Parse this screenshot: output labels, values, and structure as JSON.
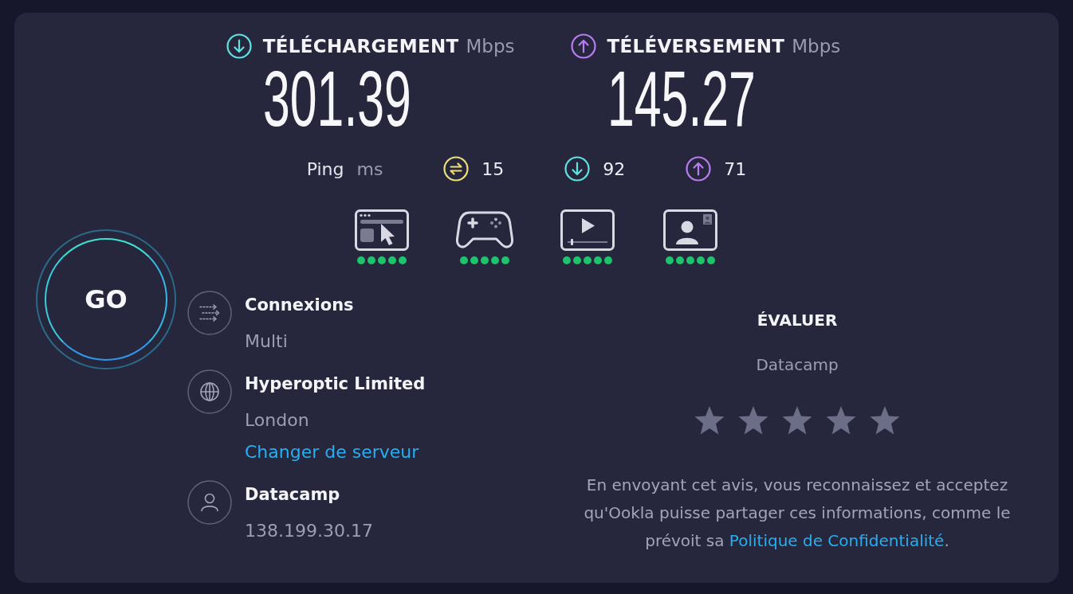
{
  "results": [
    {
      "kind": "download",
      "label": "TÉLÉCHARGEMENT",
      "unit": "Mbps",
      "value": "301.39"
    },
    {
      "kind": "upload",
      "label": "TÉLÉVERSEMENT",
      "unit": "Mbps",
      "value": "145.27"
    }
  ],
  "ping": {
    "label": "Ping",
    "unit": "ms",
    "readings": [
      {
        "kind": "idle",
        "value": "15"
      },
      {
        "kind": "download",
        "value": "92"
      },
      {
        "kind": "upload",
        "value": "71"
      }
    ]
  },
  "activities": [
    {
      "kind": "browsing",
      "stars": 5
    },
    {
      "kind": "gaming",
      "stars": 5
    },
    {
      "kind": "streaming",
      "stars": 5
    },
    {
      "kind": "video_call",
      "stars": 5
    }
  ],
  "go_button": {
    "label": "GO"
  },
  "connection": [
    {
      "kind": "connections",
      "title": "Connexions",
      "detail": "Multi"
    },
    {
      "kind": "server",
      "title": "Hyperoptic Limited",
      "detail": "London",
      "link": "Changer de serveur"
    },
    {
      "kind": "client",
      "title": "Datacamp",
      "detail": "138.199.30.17"
    }
  ],
  "rating": {
    "title": "ÉVALUER",
    "subject": "Datacamp",
    "notice": {
      "before": "En envoyant cet avis, vous reconnaissez et acceptez qu'Ookla puisse partager ces informations, comme le prévoit sa",
      "link": "Politique de Confidentialité",
      "after": "."
    }
  }
}
